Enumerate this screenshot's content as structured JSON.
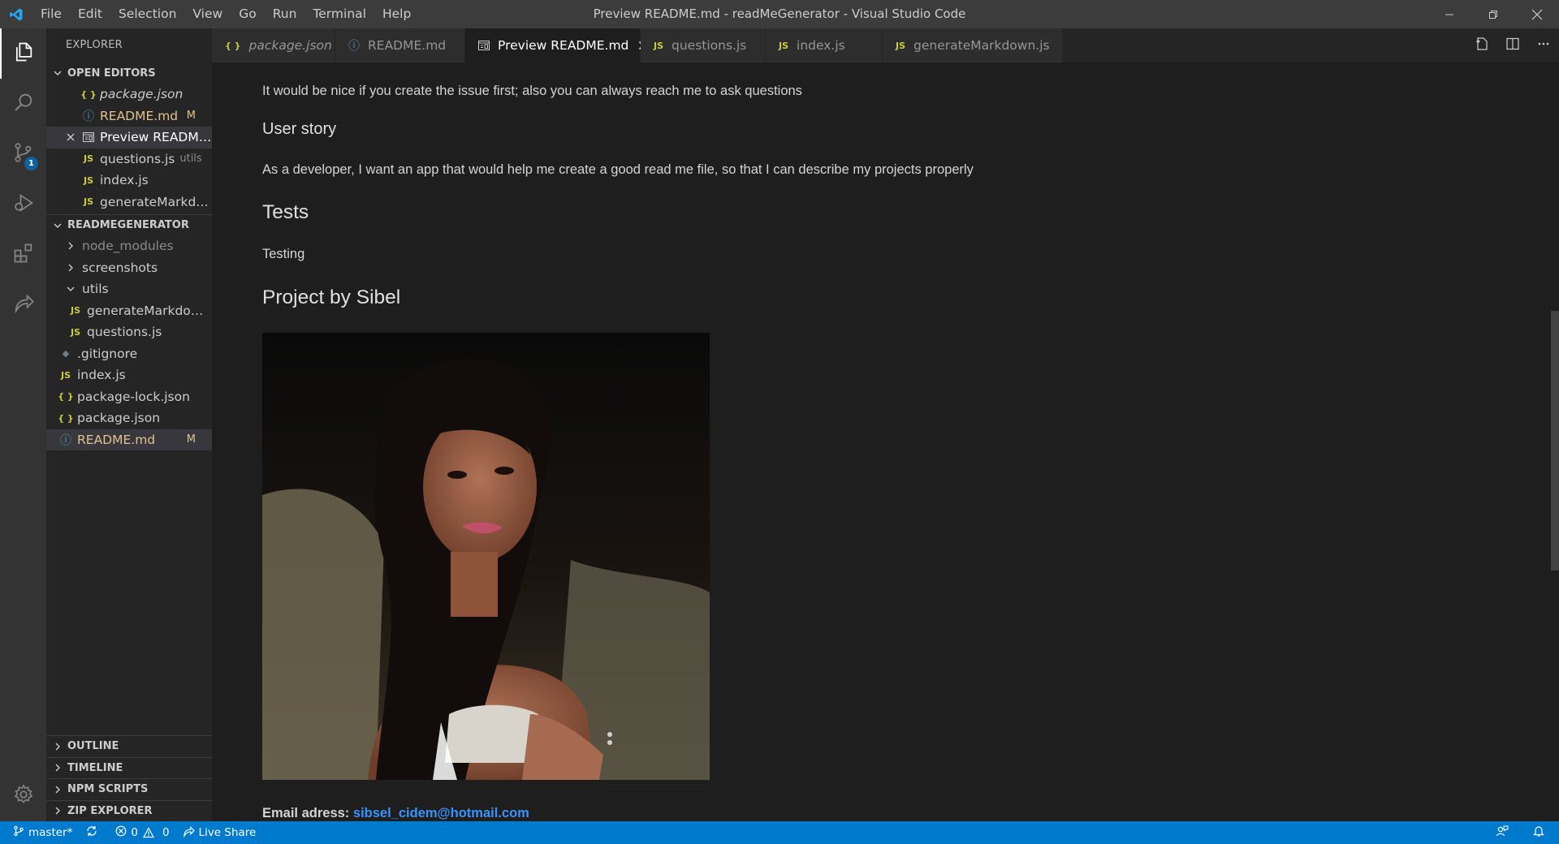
{
  "window": {
    "title": "Preview README.md - readMeGenerator - Visual Studio Code"
  },
  "menu": [
    "File",
    "Edit",
    "Selection",
    "View",
    "Go",
    "Run",
    "Terminal",
    "Help"
  ],
  "activity_bar": {
    "items": [
      "files-icon",
      "search-icon",
      "source-control-icon",
      "run-debug-icon",
      "extensions-icon",
      "live-share-icon"
    ],
    "source_control_badge": "1",
    "bottom": "gear-icon"
  },
  "sidebar": {
    "header": "EXPLORER",
    "open_editors": {
      "title": "OPEN EDITORS",
      "items": [
        {
          "icon": "{ }",
          "name": "package.json",
          "desc": "",
          "status": ""
        },
        {
          "icon": "ⓘ",
          "name": "README.md",
          "desc": "",
          "status": "M"
        },
        {
          "icon": "preview",
          "name": "Preview README....",
          "desc": "",
          "status": ""
        },
        {
          "icon": "JS",
          "name": "questions.js",
          "desc": "utils",
          "status": ""
        },
        {
          "icon": "JS",
          "name": "index.js",
          "desc": "",
          "status": ""
        },
        {
          "icon": "JS",
          "name": "generateMarkdo...",
          "desc": "",
          "status": ""
        }
      ]
    },
    "project": {
      "title": "READMEGENERATOR",
      "items": [
        {
          "name": "node_modules"
        },
        {
          "name": "screenshots"
        },
        {
          "name": "utils"
        },
        {
          "icon": "JS",
          "name": "generateMarkdown.js"
        },
        {
          "icon": "JS",
          "name": "questions.js"
        },
        {
          "icon": "◆",
          "name": ".gitignore"
        },
        {
          "icon": "JS",
          "name": "index.js"
        },
        {
          "icon": "{ }",
          "name": "package-lock.json"
        },
        {
          "icon": "{ }",
          "name": "package.json"
        },
        {
          "icon": "ⓘ",
          "name": "README.md",
          "status": "M"
        }
      ]
    },
    "bottom_sections": [
      "OUTLINE",
      "TIMELINE",
      "NPM SCRIPTS",
      "ZIP EXPLORER"
    ]
  },
  "tabs": [
    {
      "icon": "{ }",
      "label": "package.json",
      "active": false
    },
    {
      "icon": "ⓘ",
      "label": "README.md",
      "active": false
    },
    {
      "icon": "preview",
      "label": "Preview README.md",
      "active": true
    },
    {
      "icon": "JS",
      "label": "questions.js",
      "active": false
    },
    {
      "icon": "JS",
      "label": "index.js",
      "active": false
    },
    {
      "icon": "JS",
      "label": "generateMarkdown.js",
      "active": false
    }
  ],
  "preview": {
    "contributing_text": "It would be nice if you create the issue first; also you can always reach me to ask questions",
    "user_story_heading": "User story",
    "user_story_text": "As a developer, I want an app that would help me create a good read me file, so that I can describe my projects properly",
    "tests_heading": "Tests",
    "tests_text": "Testing",
    "author_heading": "Project by Sibel",
    "email_label": "Email adress:",
    "email_value": "sibsel_cidem@hotmail.com"
  },
  "status_bar": {
    "branch": "master*",
    "errors": "0",
    "warnings": "0",
    "live_share": "Live Share"
  },
  "colors": {
    "accent": "#007acc",
    "link": "#3794ff",
    "modified": "#e2c08d",
    "js_icon": "#cbcb41"
  }
}
